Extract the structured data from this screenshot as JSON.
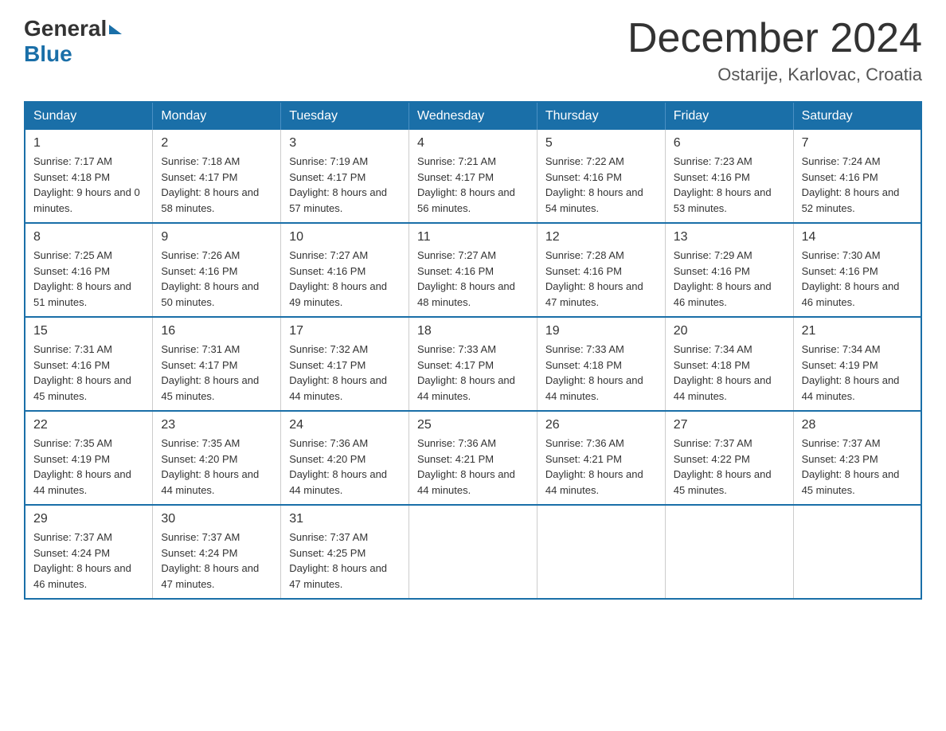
{
  "logo": {
    "general": "General",
    "blue": "Blue",
    "arrow_color": "#1a6fa8"
  },
  "header": {
    "month_title": "December 2024",
    "location": "Ostarije, Karlovac, Croatia"
  },
  "weekdays": [
    "Sunday",
    "Monday",
    "Tuesday",
    "Wednesday",
    "Thursday",
    "Friday",
    "Saturday"
  ],
  "weeks": [
    [
      {
        "day": "1",
        "sunrise": "7:17 AM",
        "sunset": "4:18 PM",
        "daylight": "9 hours and 0 minutes."
      },
      {
        "day": "2",
        "sunrise": "7:18 AM",
        "sunset": "4:17 PM",
        "daylight": "8 hours and 58 minutes."
      },
      {
        "day": "3",
        "sunrise": "7:19 AM",
        "sunset": "4:17 PM",
        "daylight": "8 hours and 57 minutes."
      },
      {
        "day": "4",
        "sunrise": "7:21 AM",
        "sunset": "4:17 PM",
        "daylight": "8 hours and 56 minutes."
      },
      {
        "day": "5",
        "sunrise": "7:22 AM",
        "sunset": "4:16 PM",
        "daylight": "8 hours and 54 minutes."
      },
      {
        "day": "6",
        "sunrise": "7:23 AM",
        "sunset": "4:16 PM",
        "daylight": "8 hours and 53 minutes."
      },
      {
        "day": "7",
        "sunrise": "7:24 AM",
        "sunset": "4:16 PM",
        "daylight": "8 hours and 52 minutes."
      }
    ],
    [
      {
        "day": "8",
        "sunrise": "7:25 AM",
        "sunset": "4:16 PM",
        "daylight": "8 hours and 51 minutes."
      },
      {
        "day": "9",
        "sunrise": "7:26 AM",
        "sunset": "4:16 PM",
        "daylight": "8 hours and 50 minutes."
      },
      {
        "day": "10",
        "sunrise": "7:27 AM",
        "sunset": "4:16 PM",
        "daylight": "8 hours and 49 minutes."
      },
      {
        "day": "11",
        "sunrise": "7:27 AM",
        "sunset": "4:16 PM",
        "daylight": "8 hours and 48 minutes."
      },
      {
        "day": "12",
        "sunrise": "7:28 AM",
        "sunset": "4:16 PM",
        "daylight": "8 hours and 47 minutes."
      },
      {
        "day": "13",
        "sunrise": "7:29 AM",
        "sunset": "4:16 PM",
        "daylight": "8 hours and 46 minutes."
      },
      {
        "day": "14",
        "sunrise": "7:30 AM",
        "sunset": "4:16 PM",
        "daylight": "8 hours and 46 minutes."
      }
    ],
    [
      {
        "day": "15",
        "sunrise": "7:31 AM",
        "sunset": "4:16 PM",
        "daylight": "8 hours and 45 minutes."
      },
      {
        "day": "16",
        "sunrise": "7:31 AM",
        "sunset": "4:17 PM",
        "daylight": "8 hours and 45 minutes."
      },
      {
        "day": "17",
        "sunrise": "7:32 AM",
        "sunset": "4:17 PM",
        "daylight": "8 hours and 44 minutes."
      },
      {
        "day": "18",
        "sunrise": "7:33 AM",
        "sunset": "4:17 PM",
        "daylight": "8 hours and 44 minutes."
      },
      {
        "day": "19",
        "sunrise": "7:33 AM",
        "sunset": "4:18 PM",
        "daylight": "8 hours and 44 minutes."
      },
      {
        "day": "20",
        "sunrise": "7:34 AM",
        "sunset": "4:18 PM",
        "daylight": "8 hours and 44 minutes."
      },
      {
        "day": "21",
        "sunrise": "7:34 AM",
        "sunset": "4:19 PM",
        "daylight": "8 hours and 44 minutes."
      }
    ],
    [
      {
        "day": "22",
        "sunrise": "7:35 AM",
        "sunset": "4:19 PM",
        "daylight": "8 hours and 44 minutes."
      },
      {
        "day": "23",
        "sunrise": "7:35 AM",
        "sunset": "4:20 PM",
        "daylight": "8 hours and 44 minutes."
      },
      {
        "day": "24",
        "sunrise": "7:36 AM",
        "sunset": "4:20 PM",
        "daylight": "8 hours and 44 minutes."
      },
      {
        "day": "25",
        "sunrise": "7:36 AM",
        "sunset": "4:21 PM",
        "daylight": "8 hours and 44 minutes."
      },
      {
        "day": "26",
        "sunrise": "7:36 AM",
        "sunset": "4:21 PM",
        "daylight": "8 hours and 44 minutes."
      },
      {
        "day": "27",
        "sunrise": "7:37 AM",
        "sunset": "4:22 PM",
        "daylight": "8 hours and 45 minutes."
      },
      {
        "day": "28",
        "sunrise": "7:37 AM",
        "sunset": "4:23 PM",
        "daylight": "8 hours and 45 minutes."
      }
    ],
    [
      {
        "day": "29",
        "sunrise": "7:37 AM",
        "sunset": "4:24 PM",
        "daylight": "8 hours and 46 minutes."
      },
      {
        "day": "30",
        "sunrise": "7:37 AM",
        "sunset": "4:24 PM",
        "daylight": "8 hours and 47 minutes."
      },
      {
        "day": "31",
        "sunrise": "7:37 AM",
        "sunset": "4:25 PM",
        "daylight": "8 hours and 47 minutes."
      },
      null,
      null,
      null,
      null
    ]
  ],
  "labels": {
    "sunrise": "Sunrise: ",
    "sunset": "Sunset: ",
    "daylight": "Daylight: "
  }
}
